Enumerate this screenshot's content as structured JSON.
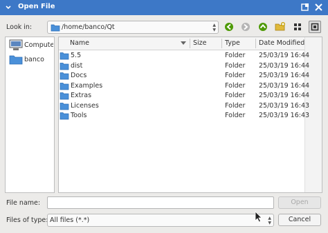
{
  "window": {
    "title": "Open File"
  },
  "lookin": {
    "label": "Look in:",
    "path": "/home/banco/Qt"
  },
  "sidebar": {
    "items": [
      {
        "label": "Computer",
        "icon": "computer-icon"
      },
      {
        "label": "banco",
        "icon": "folder-icon"
      }
    ]
  },
  "list": {
    "headers": {
      "name": "Name",
      "size": "Size",
      "type": "Type",
      "date": "Date Modified"
    },
    "rows": [
      {
        "name": "5.5",
        "size": "",
        "type": "Folder",
        "date": "25/03/19 16:44"
      },
      {
        "name": "dist",
        "size": "",
        "type": "Folder",
        "date": "25/03/19 16:44"
      },
      {
        "name": "Docs",
        "size": "",
        "type": "Folder",
        "date": "25/03/19 16:44"
      },
      {
        "name": "Examples",
        "size": "",
        "type": "Folder",
        "date": "25/03/19 16:44"
      },
      {
        "name": "Extras",
        "size": "",
        "type": "Folder",
        "date": "25/03/19 16:44"
      },
      {
        "name": "Licenses",
        "size": "",
        "type": "Folder",
        "date": "25/03/19 16:43"
      },
      {
        "name": "Tools",
        "size": "",
        "type": "Folder",
        "date": "25/03/19 16:43"
      }
    ]
  },
  "filename": {
    "label": "File name:",
    "value": ""
  },
  "filetype": {
    "label": "Files of type:",
    "value": "All files (*.*)"
  },
  "buttons": {
    "open": "Open",
    "cancel": "Cancel"
  },
  "colors": {
    "titlebar": "#3d78c7",
    "folder": "#4a90d9",
    "nav_green": "#4e9a06"
  }
}
